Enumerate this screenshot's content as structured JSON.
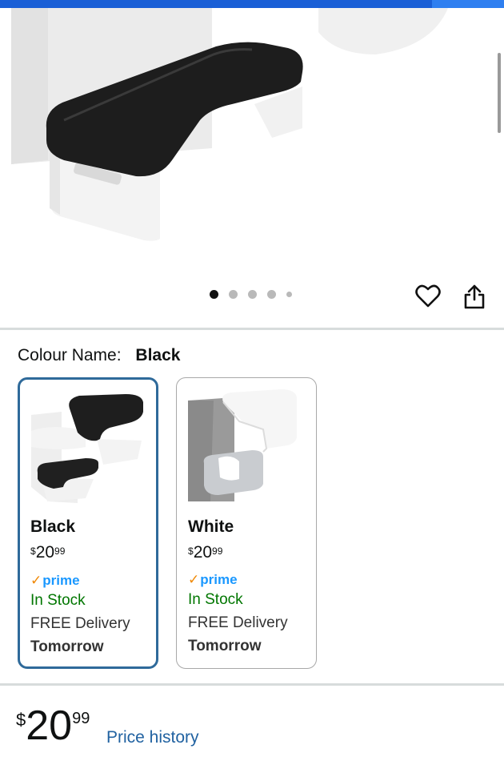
{
  "product": {
    "image_dots": {
      "count": 5,
      "active_index": 0
    },
    "actions": {
      "wishlist_icon": "heart-icon",
      "share_icon": "share-icon"
    }
  },
  "colour": {
    "label": "Colour Name:",
    "selected": "Black"
  },
  "variants": [
    {
      "name": "Black",
      "price_currency": "$",
      "price_whole": "20",
      "price_fraction": "99",
      "prime": "prime",
      "stock": "In Stock",
      "delivery": "FREE Delivery",
      "delivery_when": "Tomorrow",
      "selected": true
    },
    {
      "name": "White",
      "price_currency": "$",
      "price_whole": "20",
      "price_fraction": "99",
      "prime": "prime",
      "stock": "In Stock",
      "delivery": "FREE Delivery",
      "delivery_when": "Tomorrow",
      "selected": false
    }
  ],
  "price": {
    "currency": "$",
    "whole": "20",
    "fraction": "99",
    "history_link": "Price history"
  },
  "colors": {
    "accent_blue": "#1a5fd6",
    "selected_border": "#2f6a9a",
    "prime_blue": "#1a98ff",
    "prime_check": "#f08804",
    "in_stock_green": "#007600",
    "link_blue": "#2162a1"
  }
}
